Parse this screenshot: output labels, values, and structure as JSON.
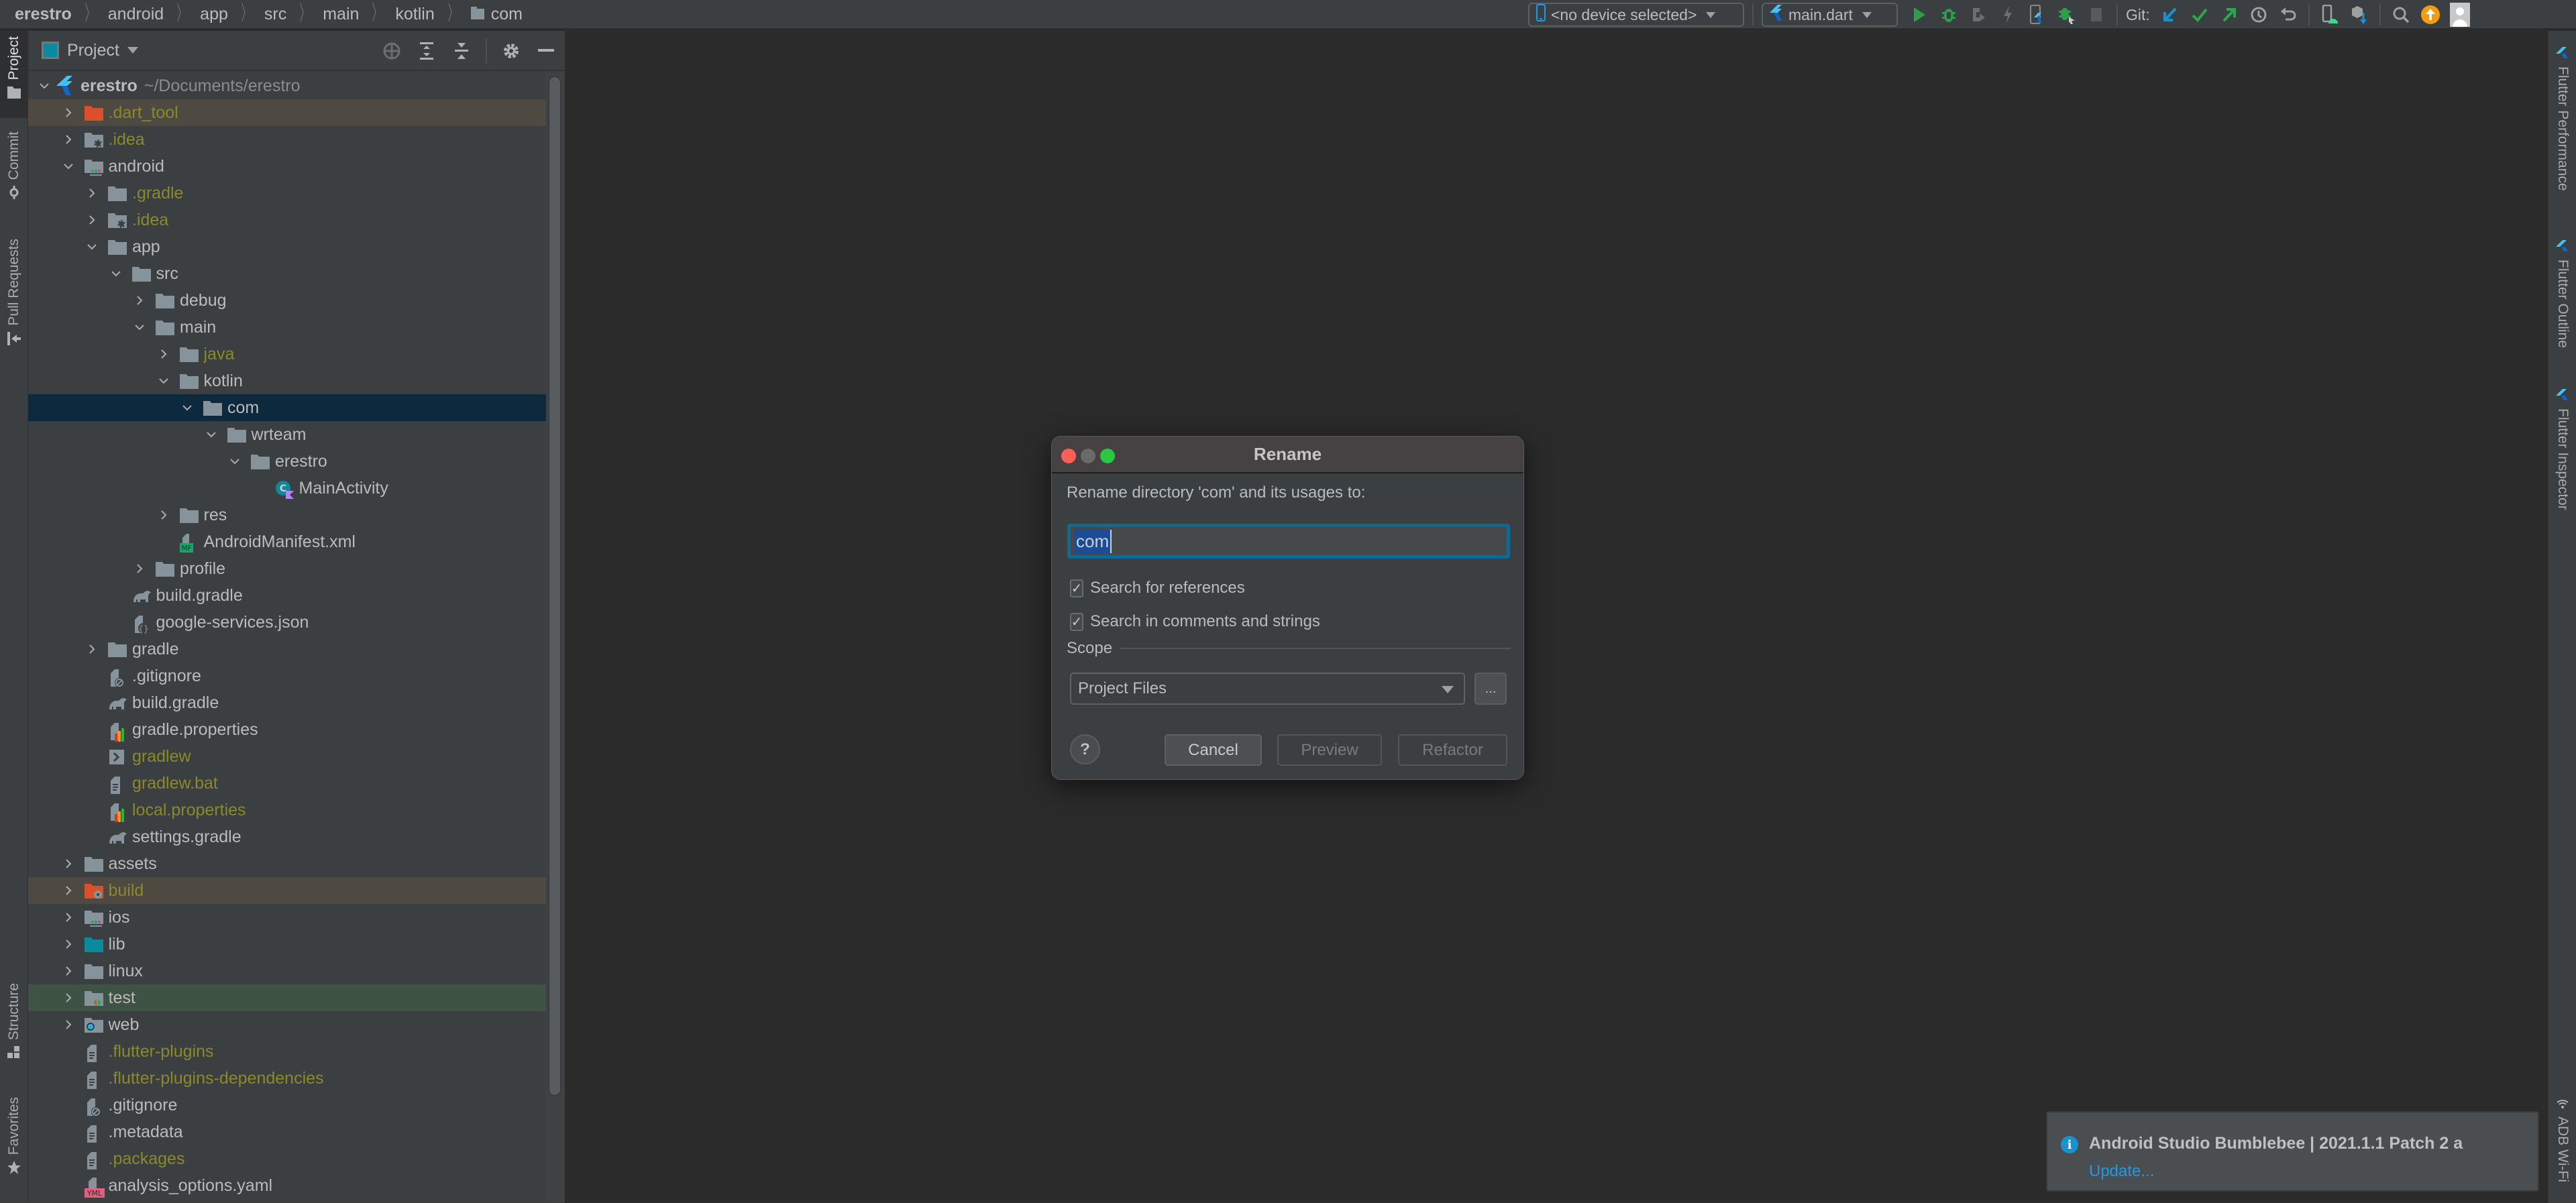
{
  "breadcrumb": [
    "erestro",
    "android",
    "app",
    "src",
    "main",
    "kotlin",
    "com"
  ],
  "toolbar": {
    "device_selector": "<no device selected>",
    "run_config": "main.dart",
    "git_label": "Git:",
    "icons": [
      "run-icon",
      "debug-icon",
      "attach-debugger-icon",
      "hot-reload-icon",
      "flutter-device-icon",
      "debug-attach-icon",
      "stop-icon",
      "git-update-icon",
      "git-commit-icon",
      "git-push-icon",
      "history-icon",
      "rollback-icon",
      "avd-manager-icon",
      "sdk-manager-icon",
      "search-icon",
      "update-available-icon",
      "avatar-icon"
    ],
    "colors": {
      "run": "#2f9e4c",
      "debug": "#2f9e4c",
      "git_update": "#1992d4",
      "git_commit": "#2ba84a",
      "update_badge": "#f49b10"
    }
  },
  "left_tool_tabs": {
    "project": "Project",
    "commit": "Commit",
    "pull_requests": "Pull Requests",
    "structure": "Structure",
    "favorites": "Favorites"
  },
  "right_tool_tabs": {
    "flutter_performance": "Flutter Performance",
    "flutter_outline": "Flutter Outline",
    "flutter_inspector": "Flutter Inspector",
    "adb_wifi": "ADB Wi-Fi"
  },
  "project_panel": {
    "title": "Project",
    "tree": [
      {
        "name": "erestro",
        "path": "~/Documents/erestro",
        "depth": 0,
        "expanded": true,
        "icon": "flutter-project",
        "style": "bold"
      },
      {
        "name": ".dart_tool",
        "depth": 1,
        "expanded": false,
        "icon": "folder-excluded",
        "style": "ignored",
        "row": "excluded"
      },
      {
        "name": ".idea",
        "depth": 1,
        "expanded": false,
        "icon": "folder-config",
        "style": "ignored"
      },
      {
        "name": "android",
        "depth": 1,
        "expanded": true,
        "icon": "folder-module"
      },
      {
        "name": ".gradle",
        "depth": 2,
        "expanded": false,
        "icon": "folder",
        "style": "ignored"
      },
      {
        "name": ".idea",
        "depth": 2,
        "expanded": false,
        "icon": "folder-config",
        "style": "ignored"
      },
      {
        "name": "app",
        "depth": 2,
        "expanded": true,
        "icon": "folder"
      },
      {
        "name": "src",
        "depth": 3,
        "expanded": true,
        "icon": "folder"
      },
      {
        "name": "debug",
        "depth": 4,
        "expanded": false,
        "icon": "folder"
      },
      {
        "name": "main",
        "depth": 4,
        "expanded": true,
        "icon": "folder"
      },
      {
        "name": "java",
        "depth": 5,
        "expanded": false,
        "icon": "folder",
        "style": "ignored"
      },
      {
        "name": "kotlin",
        "depth": 5,
        "expanded": true,
        "icon": "folder"
      },
      {
        "name": "com",
        "depth": 6,
        "expanded": true,
        "icon": "folder",
        "row": "selected"
      },
      {
        "name": "wrteam",
        "depth": 7,
        "expanded": true,
        "icon": "folder"
      },
      {
        "name": "erestro",
        "depth": 8,
        "expanded": true,
        "icon": "folder"
      },
      {
        "name": "MainActivity",
        "depth": 9,
        "icon": "kotlin-class"
      },
      {
        "name": "res",
        "depth": 5,
        "expanded": false,
        "icon": "folder"
      },
      {
        "name": "AndroidManifest.xml",
        "depth": 5,
        "icon": "manifest-file"
      },
      {
        "name": "profile",
        "depth": 4,
        "expanded": false,
        "icon": "folder"
      },
      {
        "name": "build.gradle",
        "depth": 3,
        "icon": "gradle-file"
      },
      {
        "name": "google-services.json",
        "depth": 3,
        "icon": "json-file"
      },
      {
        "name": "gradle",
        "depth": 2,
        "expanded": false,
        "icon": "folder"
      },
      {
        "name": ".gitignore",
        "depth": 2,
        "icon": "gitignore-file"
      },
      {
        "name": "build.gradle",
        "depth": 2,
        "icon": "gradle-file"
      },
      {
        "name": "gradle.properties",
        "depth": 2,
        "icon": "properties-file"
      },
      {
        "name": "gradlew",
        "depth": 2,
        "icon": "shell-file",
        "style": "ignored"
      },
      {
        "name": "gradlew.bat",
        "depth": 2,
        "icon": "text-file",
        "style": "ignored"
      },
      {
        "name": "local.properties",
        "depth": 2,
        "icon": "properties-file",
        "style": "ignored"
      },
      {
        "name": "settings.gradle",
        "depth": 2,
        "icon": "gradle-file"
      },
      {
        "name": "assets",
        "depth": 1,
        "expanded": false,
        "icon": "folder"
      },
      {
        "name": "build",
        "depth": 1,
        "expanded": false,
        "icon": "folder-excluded-config",
        "style": "ignored",
        "row": "excluded"
      },
      {
        "name": "ios",
        "depth": 1,
        "expanded": false,
        "icon": "folder-module"
      },
      {
        "name": "lib",
        "depth": 1,
        "expanded": false,
        "icon": "folder-source"
      },
      {
        "name": "linux",
        "depth": 1,
        "expanded": false,
        "icon": "folder"
      },
      {
        "name": "test",
        "depth": 1,
        "expanded": false,
        "icon": "folder-test",
        "row": "test"
      },
      {
        "name": "web",
        "depth": 1,
        "expanded": false,
        "icon": "folder-web"
      },
      {
        "name": ".flutter-plugins",
        "depth": 1,
        "icon": "text-file",
        "style": "ignored"
      },
      {
        "name": ".flutter-plugins-dependencies",
        "depth": 1,
        "icon": "text-file",
        "style": "ignored"
      },
      {
        "name": ".gitignore",
        "depth": 1,
        "icon": "gitignore-file"
      },
      {
        "name": ".metadata",
        "depth": 1,
        "icon": "text-file"
      },
      {
        "name": ".packages",
        "depth": 1,
        "icon": "text-file",
        "style": "ignored"
      },
      {
        "name": "analysis_options.yaml",
        "depth": 1,
        "icon": "yaml-file"
      }
    ]
  },
  "dialog": {
    "title": "Rename",
    "prompt": "Rename directory 'com' and its usages to:",
    "input_value": "com",
    "checkboxes": [
      {
        "label": "Search for references",
        "checked": true
      },
      {
        "label": "Search in comments and strings",
        "checked": true
      }
    ],
    "scope_label": "Scope",
    "scope_value": "Project Files",
    "more_button": "...",
    "help_button": "?",
    "buttons": {
      "cancel": "Cancel",
      "preview": "Preview",
      "refactor": "Refactor"
    }
  },
  "notification": {
    "title": "Android Studio Bumblebee | 2021.1.1 Patch 2 a",
    "link": "Update..."
  }
}
